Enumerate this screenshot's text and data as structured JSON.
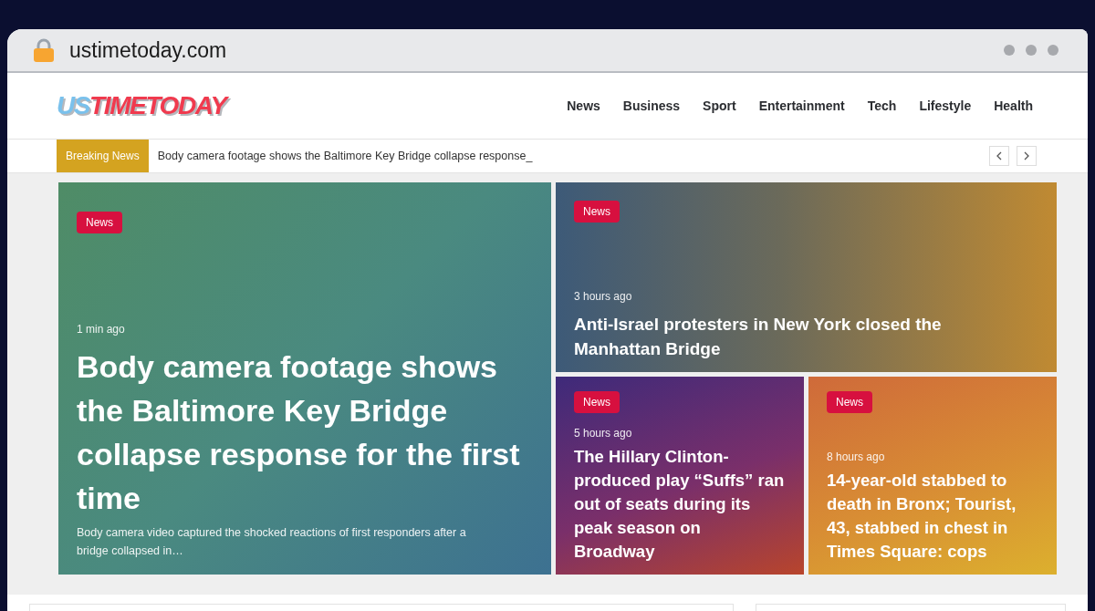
{
  "browser": {
    "url": "ustimetoday.com"
  },
  "site": {
    "logo": [
      {
        "text": "US",
        "color": "#7ac1ec"
      },
      {
        "text": "TIMETODAY",
        "color": "#f03a4e"
      }
    ],
    "nav": [
      "News",
      "Business",
      "Sport",
      "Entertainment",
      "Tech",
      "Lifestyle",
      "Health"
    ]
  },
  "ticker": {
    "label": "Breaking News",
    "headline": "Body camera footage shows the Baltimore Key Bridge collapse response_"
  },
  "stories": [
    {
      "kind": "lead",
      "category": "News",
      "time": "1 min ago",
      "title": "Body camera footage shows the Baltimore Key Bridge collapse response for the first time",
      "excerpt": "Body camera video captured the shocked reactions of first responders after a bridge collapsed in…"
    },
    {
      "kind": "wide",
      "category": "News",
      "time": "3 hours ago",
      "title": "Anti-Israel protesters in New York closed the Manhattan Bridge"
    },
    {
      "kind": "small",
      "category": "News",
      "time": "5 hours ago",
      "title": "The Hillary Clinton-produced play “Suffs” ran out of seats during its peak season on Broadway"
    },
    {
      "kind": "small",
      "category": "News",
      "time": "8 hours ago",
      "title": "14-year-old stabbed to death in Bronx; Tourist, 43, stabbed in chest in Times Square: cops"
    }
  ]
}
